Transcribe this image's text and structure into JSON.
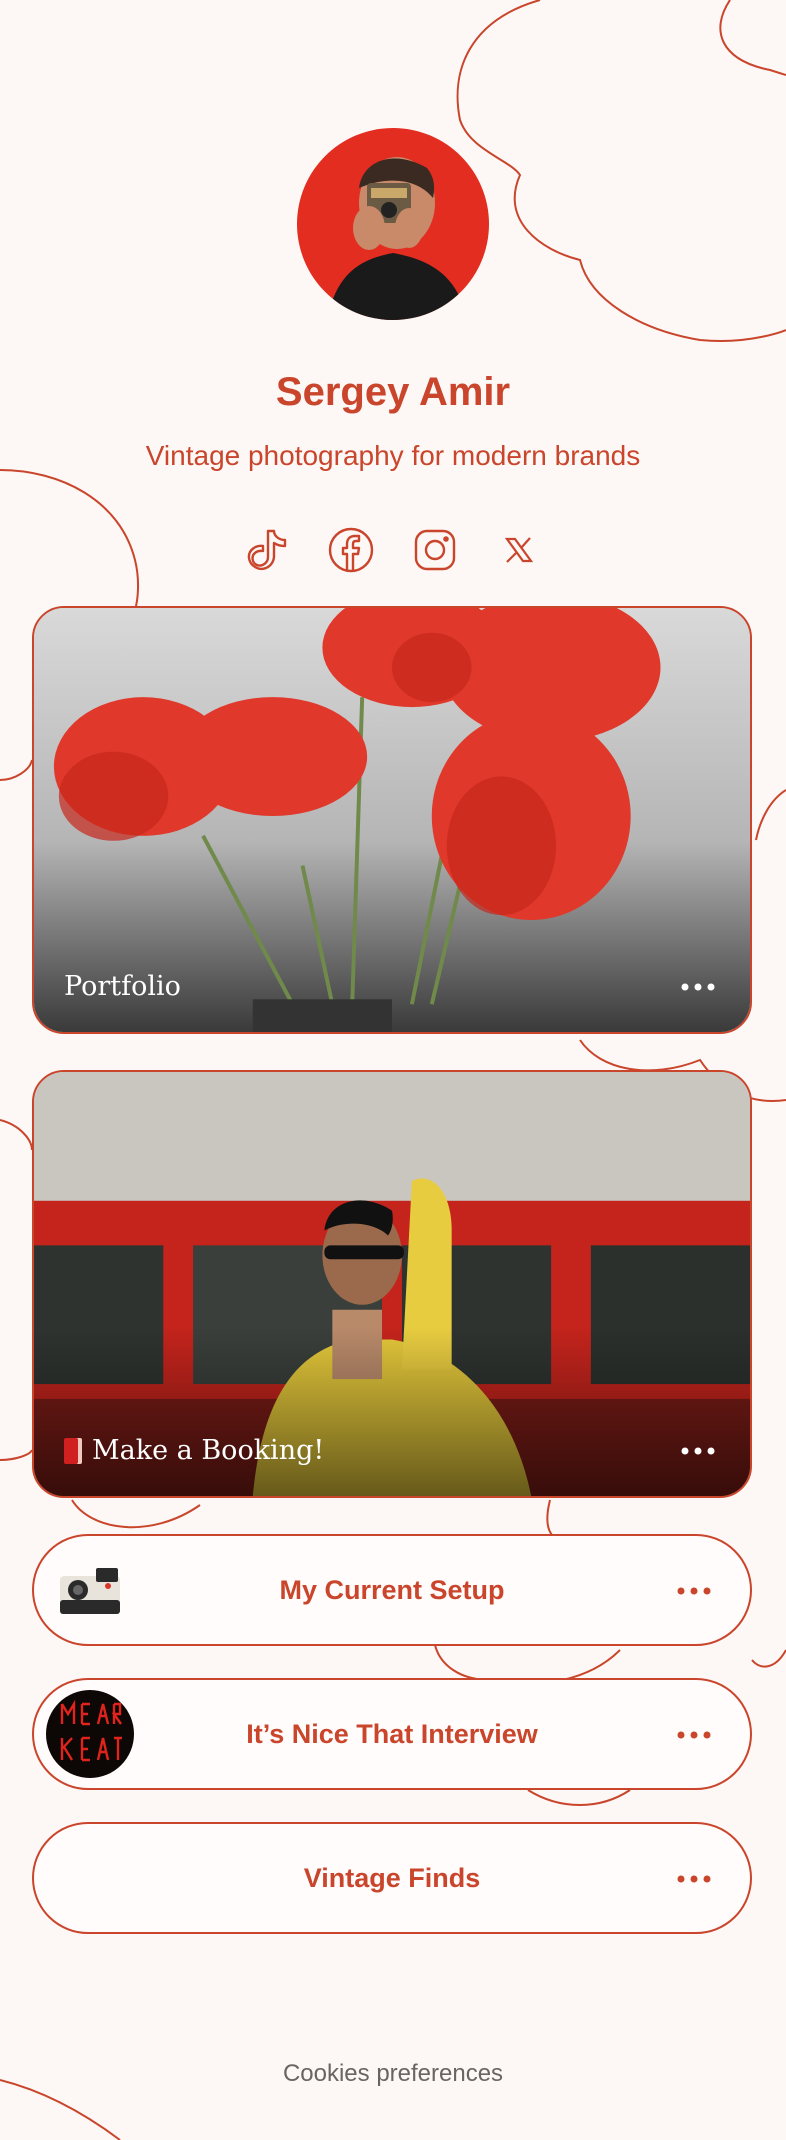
{
  "profile": {
    "name": "Sergey Amir",
    "tagline": "Vintage photography for modern brands"
  },
  "socials": [
    {
      "icon": "tiktok-icon"
    },
    {
      "icon": "facebook-icon"
    },
    {
      "icon": "instagram-icon"
    },
    {
      "icon": "x-icon"
    }
  ],
  "cards": [
    {
      "title": "Portfolio",
      "image": "red-poppies-photo"
    },
    {
      "title": "Make a Booking!",
      "icon": "book-icon",
      "image": "woman-yellow-jacket-photo"
    }
  ],
  "links": [
    {
      "label": "My Current Setup",
      "thumb": "instant-camera-thumb"
    },
    {
      "label": "It’s Nice That Interview",
      "thumb": "neon-sign-thumb"
    },
    {
      "label": "Vintage Finds"
    }
  ],
  "footer": {
    "cookies": "Cookies preferences"
  },
  "colors": {
    "accent": "#c9452b",
    "background": "#fdf7f5",
    "footer_text": "#6b6462"
  }
}
